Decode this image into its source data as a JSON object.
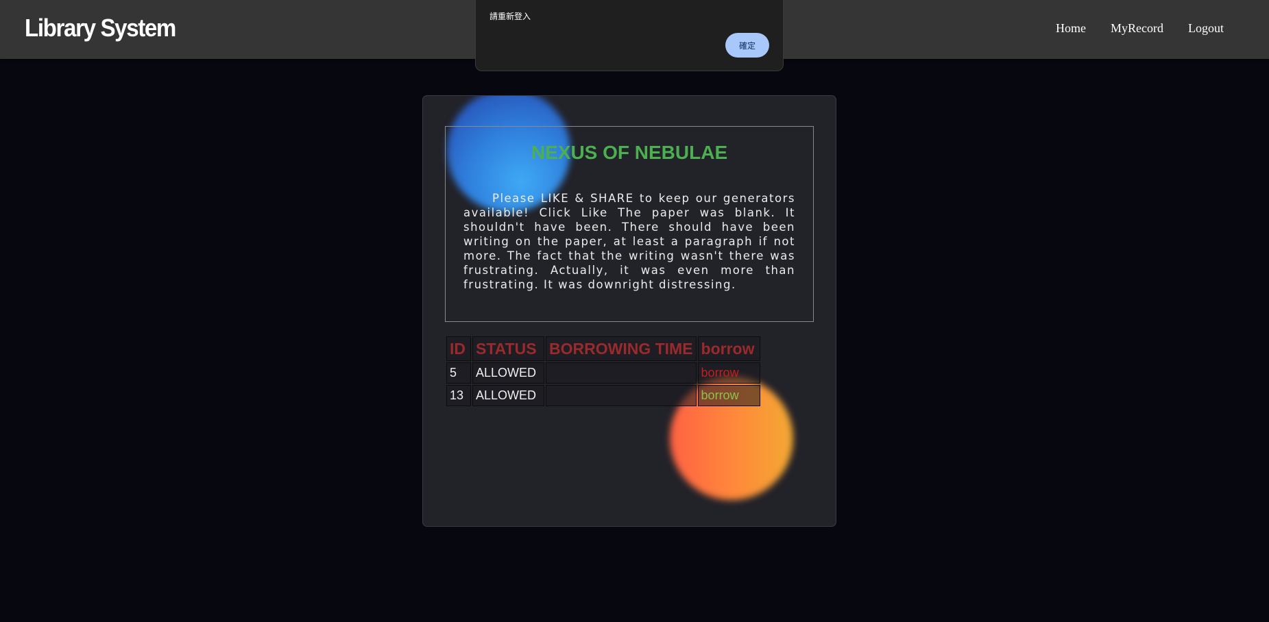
{
  "navbar": {
    "brand": "Library System",
    "links": [
      "Home",
      "MyRecord",
      "Logout"
    ]
  },
  "dialog": {
    "message": "請重新登入",
    "ok_label": "確定"
  },
  "book": {
    "title": "NEXUS OF NEBULAE",
    "description": "Please LIKE & SHARE to keep our generators available! Click Like The paper was blank. It shouldn't have been. There should have been writing on the paper, at least a paragraph if not more. The fact that the writing wasn't there was frustrating. Actually, it was even more than frustrating. It was downright distressing."
  },
  "table": {
    "headers": [
      "ID",
      "STATUS",
      "BORROWING TIME",
      "borrow"
    ],
    "rows": [
      {
        "id": "5",
        "status": "ALLOWED",
        "borrowing_time": "",
        "action": "borrow",
        "action_color": "#c41e1e"
      },
      {
        "id": "13",
        "status": "ALLOWED",
        "borrowing_time": "",
        "action": "borrow",
        "action_color": "#8bc34a"
      }
    ]
  },
  "colors": {
    "background": "#07070f",
    "navbar": "#353535",
    "card": "#222229",
    "title_green": "#4caf50",
    "header_red": "#9b2a2c",
    "dialog_button": "#a8c7fa"
  }
}
